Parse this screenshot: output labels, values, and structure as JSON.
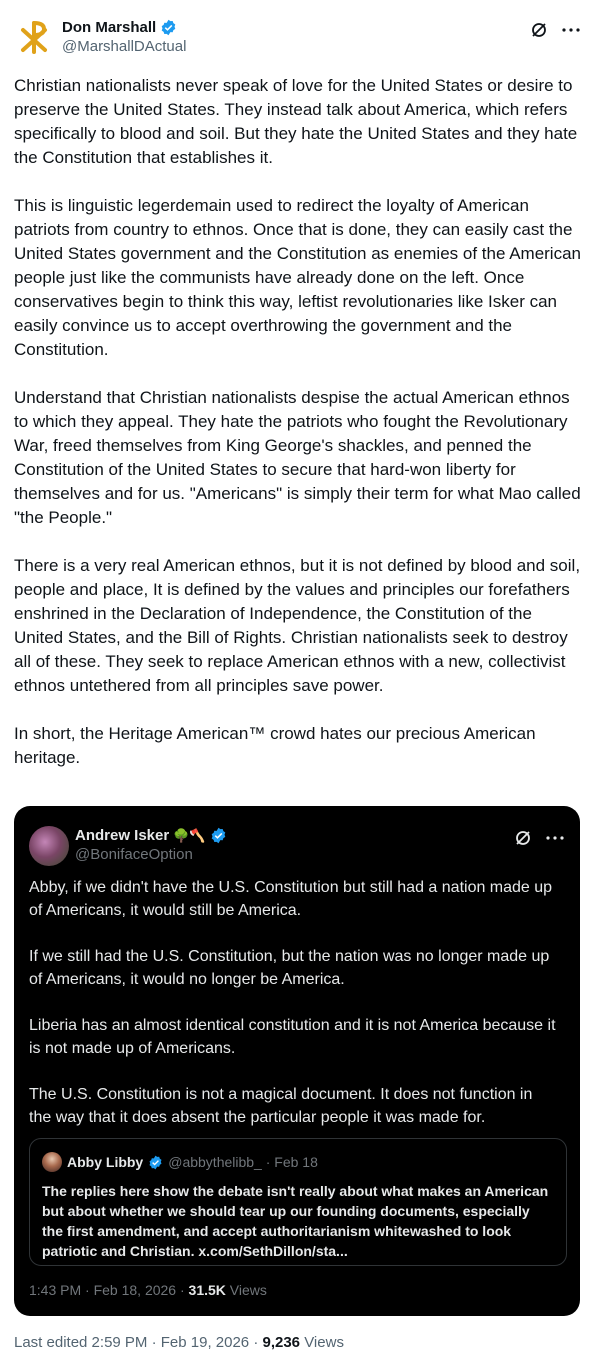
{
  "author": {
    "display_name": "Don Marshall",
    "handle": "@MarshallDActual",
    "avatar_icon": "chi-rho-icon",
    "verified_color": "#1d9bf0"
  },
  "post": {
    "paragraphs": [
      "Christian nationalists never speak of love for the United States or desire to preserve the United States. They instead talk about America, which refers specifically to blood and soil. But they hate the United States and they hate the Constitution that establishes it.",
      "This is linguistic legerdemain used to redirect the loyalty of American patriots from country to ethnos. Once that is done, they can easily cast the United States government and the Constitution as enemies of the American people just like the communists have already done on the left. Once conservatives begin to think this way, leftist revolutionaries like Isker can easily convince us to accept overthrowing the government and the Constitution.",
      "Understand that Christian nationalists despise the actual American ethnos to which they appeal. They hate the patriots who fought the Revolutionary War, freed themselves from King George's shackles, and penned the Constitution of the United States to secure that hard-won liberty for themselves and for us. \"Americans\" is simply their term for what Mao called \"the People.\"",
      "There is a very real American ethnos, but it is not defined by blood and soil, people and place, It is defined by the values and principles our forefathers enshrined in the Declaration of Independence, the Constitution of the United States, and the Bill of Rights. Christian nationalists seek to destroy all of these. They seek to replace American ethnos with a new, collectivist ethnos untethered from all principles save power.",
      "In short, the Heritage American™ crowd hates our precious American heritage."
    ],
    "edited_label": "Last edited 2:59 PM · Feb 19, 2026 · ",
    "views_count": "9,236",
    "views_label": " Views"
  },
  "quoted": {
    "display_name": "Andrew Isker",
    "name_emojis": "🌳🪓",
    "handle": "@BonifaceOption",
    "paragraphs": [
      "Abby, if we didn't have the U.S. Constitution but still had a nation made up of Americans, it would still be America.",
      "If we still had the U.S. Constitution, but the nation was no longer made up of Americans, it would no longer be America.",
      "Liberia has an almost identical constitution and it is not America because it is not made up of Americans.",
      "The U.S. Constitution is not a magical document. It does not function in the way that it does absent the particular people it was made for."
    ],
    "timestamp": "1:43 PM · Feb 18, 2026 · ",
    "views_count": "31.5K",
    "views_label": " Views",
    "inner": {
      "display_name": "Abby Libby",
      "handle_date": "@abbythelibb_ · Feb 18",
      "text": "The replies here show the debate isn't really about what makes an American but about whether we should tear up our founding documents, especially the first amendment, and accept authoritarianism whitewashed to look patriotic and Christian. x.com/SethDillon/sta..."
    }
  },
  "colors": {
    "accent_blue": "#1d9bf0",
    "logo_gold": "#e0a21a"
  }
}
